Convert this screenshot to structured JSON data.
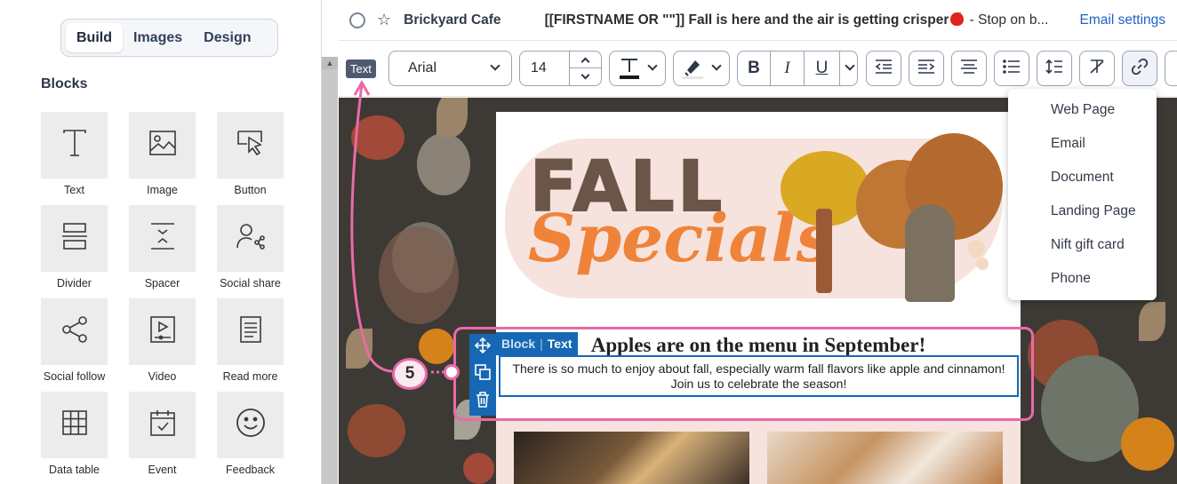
{
  "left_panel": {
    "tabs": [
      {
        "label": "Build",
        "active": true
      },
      {
        "label": "Images",
        "active": false
      },
      {
        "label": "Design",
        "active": false
      }
    ],
    "section_title": "Blocks",
    "blocks": [
      {
        "label": "Text",
        "icon": "text-icon"
      },
      {
        "label": "Image",
        "icon": "image-icon"
      },
      {
        "label": "Button",
        "icon": "button-cursor-icon"
      },
      {
        "label": "Divider",
        "icon": "divider-icon"
      },
      {
        "label": "Spacer",
        "icon": "spacer-icon"
      },
      {
        "label": "Social share",
        "icon": "social-share-icon"
      },
      {
        "label": "Social follow",
        "icon": "share-nodes-icon"
      },
      {
        "label": "Video",
        "icon": "video-icon"
      },
      {
        "label": "Read more",
        "icon": "read-more-icon"
      },
      {
        "label": "Data table",
        "icon": "table-icon"
      },
      {
        "label": "Event",
        "icon": "calendar-check-icon"
      },
      {
        "label": "Feedback",
        "icon": "smiley-icon"
      }
    ]
  },
  "header": {
    "campaign_name": "Brickyard Cafe",
    "subject_prefix": "[[FIRSTNAME OR \"\"]] Fall is here and the air is getting crisper",
    "subject_suffix": " - Stop on b...",
    "email_settings_label": "Email settings"
  },
  "toolbar": {
    "text_badge": "Text",
    "font_family": "Arial",
    "font_size": "14",
    "text_color": "#1a1a1a",
    "bold": "B",
    "italic": "I",
    "underline": "U"
  },
  "link_menu": {
    "items": [
      "Web Page",
      "Email",
      "Document",
      "Landing Page",
      "Nift gift card",
      "Phone"
    ]
  },
  "email": {
    "fall_title": "FALL",
    "specials_title": "Specials",
    "headline": "Apples are on the menu in September!",
    "body_text": "There is so much to enjoy about fall, especially warm fall flavors like apple and cinnamon! Join us to celebrate the season!",
    "block_tag_block": "Block",
    "block_tag_text": "Text"
  },
  "annotation": {
    "step_number": "5"
  },
  "colors": {
    "accent_pink": "#ea6aa7",
    "selection_blue": "#1668b4",
    "link_blue": "#1f63c6",
    "specials_orange": "#f0833a",
    "fall_brown": "#6b5448"
  }
}
